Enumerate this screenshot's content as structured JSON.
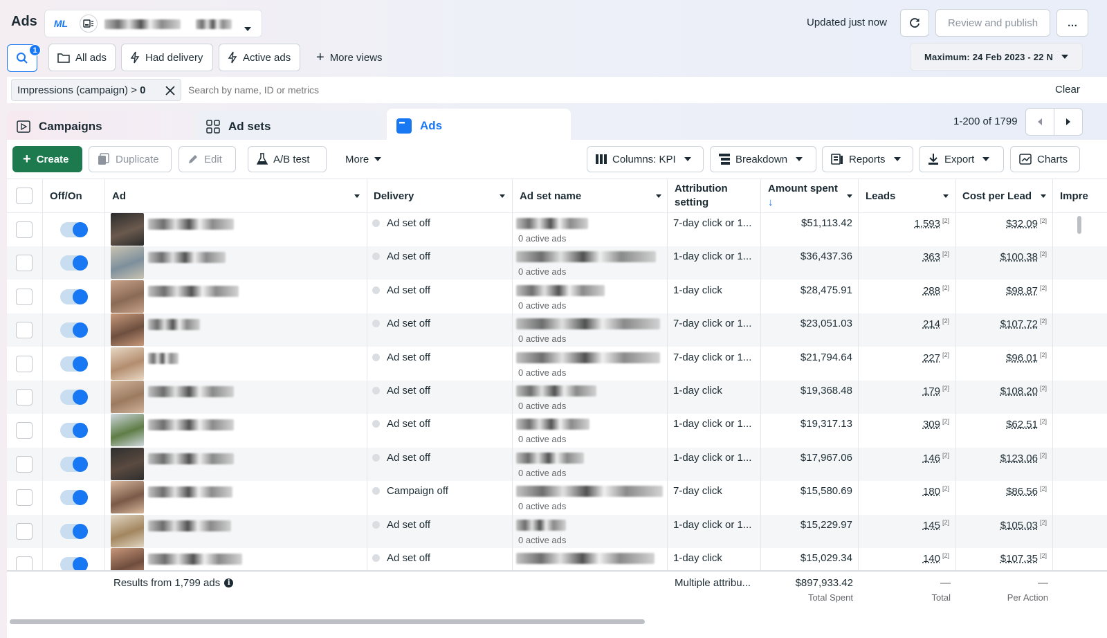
{
  "header": {
    "app_title": "Ads",
    "account_initials": "ML",
    "updated_text": "Updated just now",
    "review_publish_label": "Review and publish",
    "more_label": "…"
  },
  "views": {
    "search_badge": "1",
    "all_ads": "All ads",
    "had_delivery": "Had delivery",
    "active_ads": "Active ads",
    "more_views": "More views",
    "date_range": "Maximum: 24 Feb 2023 - 22 N"
  },
  "filter": {
    "chip_text": "Impressions (campaign) > ",
    "chip_value": "0",
    "search_placeholder": "Search by name, ID or metrics",
    "clear_label": "Clear"
  },
  "tabs": {
    "campaigns": "Campaigns",
    "ad_sets": "Ad sets",
    "ads": "Ads",
    "pagination": "1-200 of 1799"
  },
  "toolbar": {
    "create": "Create",
    "duplicate": "Duplicate",
    "edit": "Edit",
    "ab_test": "A/B test",
    "more": "More",
    "columns": "Columns: KPI",
    "breakdown": "Breakdown",
    "reports": "Reports",
    "export": "Export",
    "charts": "Charts"
  },
  "columns": {
    "off_on": "Off/On",
    "ad": "Ad",
    "delivery": "Delivery",
    "ad_set_name": "Ad set name",
    "attribution_line1": "Attribution",
    "attribution_line2": "setting",
    "amount_spent": "Amount spent",
    "leads": "Leads",
    "cost_per_lead": "Cost per Lead",
    "impressions": "Impre"
  },
  "rows": [
    {
      "delivery": "Ad set off",
      "sub": "0 active ads",
      "attribution": "7-day click or 1...",
      "spent": "$51,113.42",
      "leads": "1,593",
      "cpl": "$32.09",
      "note": "[2]",
      "note2": "[2]"
    },
    {
      "delivery": "Ad set off",
      "sub": "0 active ads",
      "attribution": "1-day click or 1...",
      "spent": "$36,437.36",
      "leads": "363",
      "cpl": "$100.38",
      "note": "[2]",
      "note2": "[2]"
    },
    {
      "delivery": "Ad set off",
      "sub": "0 active ads",
      "attribution": "1-day click",
      "spent": "$28,475.91",
      "leads": "288",
      "cpl": "$98.87",
      "note": "[2]",
      "note2": "[2]"
    },
    {
      "delivery": "Ad set off",
      "sub": "0 active ads",
      "attribution": "7-day click or 1...",
      "spent": "$23,051.03",
      "leads": "214",
      "cpl": "$107.72",
      "note": "[2]",
      "note2": "[2]"
    },
    {
      "delivery": "Ad set off",
      "sub": "0 active ads",
      "attribution": "7-day click or 1...",
      "spent": "$21,794.64",
      "leads": "227",
      "cpl": "$96.01",
      "note": "[2]",
      "note2": "[2]"
    },
    {
      "delivery": "Ad set off",
      "sub": "0 active ads",
      "attribution": "1-day click",
      "spent": "$19,368.48",
      "leads": "179",
      "cpl": "$108.20",
      "note": "[2]",
      "note2": "[2]"
    },
    {
      "delivery": "Ad set off",
      "sub": "0 active ads",
      "attribution": "1-day click or 1...",
      "spent": "$19,317.13",
      "leads": "309",
      "cpl": "$62.51",
      "note": "[2]",
      "note2": "[2]"
    },
    {
      "delivery": "Ad set off",
      "sub": "0 active ads",
      "attribution": "1-day click or 1...",
      "spent": "$17,967.06",
      "leads": "146",
      "cpl": "$123.06",
      "note": "[2]",
      "note2": "[2]"
    },
    {
      "delivery": "Campaign off",
      "sub": "0 active ads",
      "attribution": "7-day click",
      "spent": "$15,580.69",
      "leads": "180",
      "cpl": "$86.56",
      "note": "[2]",
      "note2": "[2]"
    },
    {
      "delivery": "Ad set off",
      "sub": "0 active ads",
      "attribution": "1-day click or 1...",
      "spent": "$15,229.97",
      "leads": "145",
      "cpl": "$105.03",
      "note": "[2]",
      "note2": "[2]"
    },
    {
      "delivery": "Ad set off",
      "sub": "",
      "attribution": "1-day click",
      "spent": "$15,029.34",
      "leads": "140",
      "cpl": "$107.35",
      "note": "[2]",
      "note2": "[2]"
    }
  ],
  "footer": {
    "results": "Results from 1,799 ads",
    "attribution": "Multiple attribu...",
    "total_spent": "$897,933.42",
    "total_spent_label": "Total Spent",
    "leads_dash": "—",
    "leads_label": "Total",
    "cpl_dash": "—",
    "cpl_label": "Per Action"
  },
  "colors": {
    "accent": "#1877f2",
    "create_green": "#1d7a4f"
  }
}
